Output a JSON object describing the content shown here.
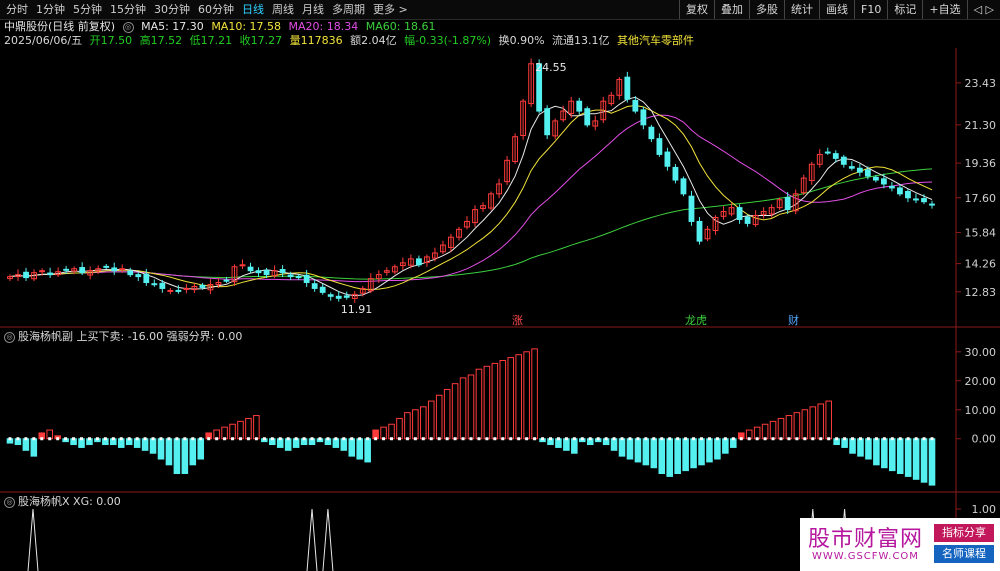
{
  "toolbar": {
    "periods": [
      "分时",
      "1分钟",
      "5分钟",
      "15分钟",
      "30分钟",
      "60分钟",
      "日线",
      "周线",
      "月线",
      "多周期",
      "更多 >"
    ],
    "active_period": "日线",
    "right_buttons": [
      "复权",
      "叠加",
      "多股",
      "统计",
      "画线",
      "F10",
      "标记",
      "+自选",
      "◁ ▷"
    ]
  },
  "stock": {
    "title": "中鼎股份(日线 前复权)",
    "ma5": "MA5: 17.30",
    "ma10": "MA10: 17.58",
    "ma20": "MA20: 18.34",
    "ma60": "MA60: 18.61",
    "date": "2025/06/06/五",
    "open": "开17.50",
    "high": "高17.52",
    "low": "低17.21",
    "close": "收17.27",
    "volume": "量117836",
    "amount": "额2.04亿",
    "change": "幅-0.33(-1.87%)",
    "turnover": "换0.90%",
    "float_cap": "流通13.1亿",
    "sector": "其他汽车零部件"
  },
  "colors": {
    "up": "#ff3b3b",
    "down": "#54f0f0",
    "ma5": "#e8e8e8",
    "ma10": "#f2e33a",
    "ma20": "#e24de6",
    "ma60": "#3ccf3c",
    "ind_pos": "#ff3b3b",
    "ind_neg": "#54f0f0"
  },
  "main_axis": [
    "23.43",
    "21.30",
    "19.36",
    "17.60",
    "15.84",
    "14.26",
    "12.83"
  ],
  "annotations": {
    "high_label": "24.55",
    "low_label": "11.91",
    "markers": [
      "涨",
      "龙虎",
      "财"
    ]
  },
  "panel2": {
    "title": "股海杨帆副 上买下卖: -16.00 强弱分界: 0.00",
    "axis": [
      "30.00",
      "20.00",
      "10.00",
      "0.00"
    ]
  },
  "panel3": {
    "title": "股海杨帆X XG: 0.00",
    "axis": [
      "1.00"
    ]
  },
  "watermark": {
    "logo": "股市财富网",
    "url": "WWW.GSCFW.COM",
    "badge1": "指标分享",
    "badge2": "名师课程"
  },
  "chart_data": [
    {
      "type": "candlestick",
      "ylim": [
        11.5,
        25.2
      ],
      "ticks": [
        23.43,
        21.3,
        19.36,
        17.6,
        15.84,
        14.26,
        12.83
      ],
      "closes": [
        13.6,
        13.7,
        13.55,
        13.8,
        13.9,
        13.7,
        13.85,
        13.95,
        14.0,
        13.8,
        13.9,
        14.0,
        14.1,
        13.9,
        14.0,
        13.7,
        13.6,
        13.3,
        13.2,
        13.0,
        12.9,
        12.85,
        13.0,
        13.1,
        13.05,
        13.2,
        13.3,
        13.4,
        14.1,
        14.2,
        13.9,
        13.8,
        13.7,
        13.9,
        13.8,
        13.6,
        13.55,
        13.3,
        13.0,
        12.8,
        12.6,
        12.5,
        12.55,
        12.7,
        13.0,
        13.5,
        13.7,
        13.9,
        14.1,
        14.3,
        14.5,
        14.2,
        14.6,
        14.8,
        15.2,
        15.6,
        16.0,
        16.4,
        17.0,
        17.2,
        17.8,
        18.3,
        19.5,
        20.7,
        22.5,
        24.4,
        22.0,
        20.8,
        21.5,
        22.0,
        22.5,
        22.0,
        21.3,
        21.5,
        22.5,
        22.8,
        23.6,
        22.6,
        22.0,
        21.3,
        20.6,
        19.8,
        19.2,
        18.5,
        17.8,
        16.4,
        15.4,
        16.0,
        16.6,
        16.9,
        17.1,
        16.5,
        16.3,
        16.7,
        16.9,
        17.1,
        17.5,
        17.0,
        17.8,
        18.6,
        19.3,
        19.8,
        19.9,
        19.6,
        19.3,
        19.1,
        18.9,
        18.7,
        18.5,
        18.3,
        18.1,
        17.8,
        17.6,
        17.5,
        17.4,
        17.27
      ]
    },
    {
      "type": "bar",
      "name": "上买下卖",
      "ylim": [
        -17,
        32
      ],
      "values": [
        -1.5,
        -2,
        -4,
        -6,
        2,
        3,
        1,
        -1,
        -2,
        -3,
        -2,
        -1,
        -2,
        -2,
        -3,
        -2,
        -3,
        -4,
        -5,
        -7,
        -9,
        -12,
        -12,
        -9,
        -7,
        2,
        3,
        4,
        5,
        6,
        7,
        8,
        -1,
        -2,
        -3,
        -4,
        -3,
        -2,
        -2,
        -1,
        -2,
        -3,
        -4,
        -6,
        -7,
        -8,
        3,
        4,
        5,
        7,
        9,
        10,
        11,
        13,
        15,
        17,
        19,
        21,
        22,
        24,
        25,
        26,
        27,
        28,
        29,
        30,
        31,
        -1,
        -2,
        -3,
        -4,
        -5,
        -1,
        -2,
        -1,
        -2,
        -4,
        -6,
        -7,
        -8,
        -9,
        -10,
        -12,
        -13,
        -12,
        -11,
        -10,
        -9,
        -8,
        -7,
        -5,
        -3,
        2,
        3,
        4,
        5,
        6,
        7,
        8,
        9,
        10,
        11,
        12,
        13,
        -2,
        -3,
        -5,
        -6,
        -7,
        -9,
        -10,
        -11,
        -12,
        -13,
        -14,
        -15,
        -16
      ]
    },
    {
      "type": "line",
      "name": "XG",
      "ylim": [
        0,
        1
      ],
      "signal_indices": [
        38,
        40,
        101,
        105
      ]
    }
  ]
}
